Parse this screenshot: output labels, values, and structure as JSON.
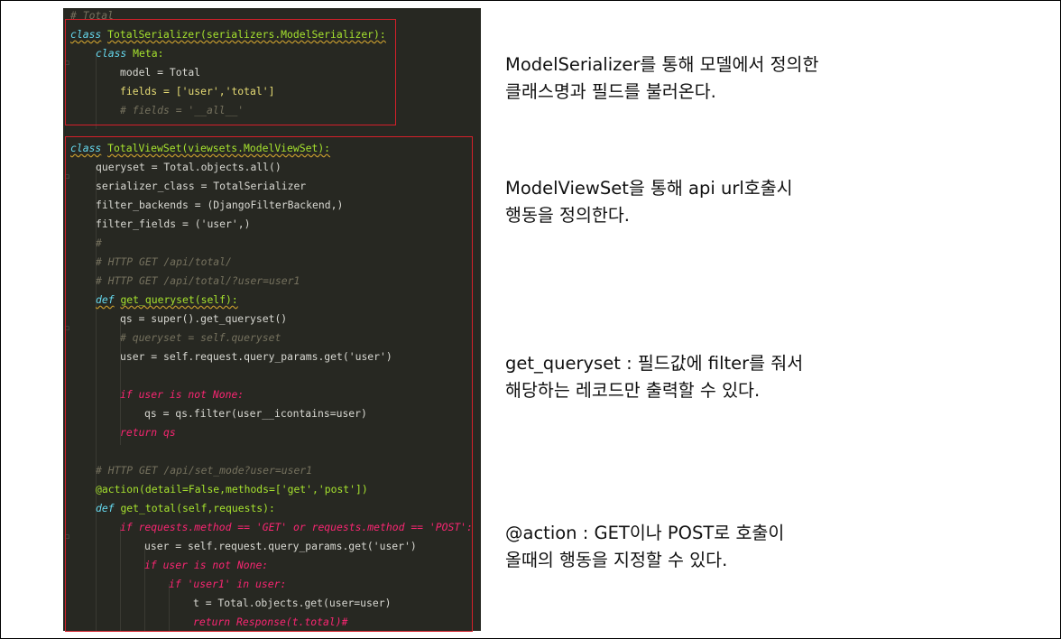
{
  "code": {
    "header_comment": "# Total",
    "serializer": {
      "class_line": "TotalSerializer(serializers.ModelSerializer):",
      "meta_line": "Meta:",
      "model_line": "model = Total",
      "fields_line": "fields = ['user','total']",
      "fields_all_comment": "# fields = '__all__'"
    },
    "viewset": {
      "class_line": "TotalViewSet(viewsets.ModelViewSet):",
      "queryset_line": "queryset = Total.objects.all()",
      "serializer_class_line": "serializer_class = TotalSerializer",
      "filter_backends_line": "filter_backends = (DjangoFilterBackend,)",
      "filter_fields_line": "filter_fields = ('user',)",
      "comment_hash": "#",
      "comment_get_total": "# HTTP GET /api/total/",
      "comment_get_user": "# HTTP GET /api/total/?user=user1",
      "def_get_queryset": "get_queryset(self):",
      "qs_super": "qs = super().get_queryset()",
      "comment_queryset": "# queryset = self.queryset",
      "user_param": "user = self.request.query_params.get('user')",
      "if_user": "if user is not None:",
      "qs_filter": "qs = qs.filter(user__icontains=user)",
      "return_qs": "return qs",
      "comment_set_mode": "# HTTP GET /api/set_mode?user=user1",
      "action_decorator": "@action(detail=False,methods=['get','post'])",
      "def_get_total": "get_total(self,requests):",
      "if_method": "if requests.method == 'GET' or requests.method == 'POST':",
      "user_param2": "user = self.request.query_params.get('user')",
      "if_user2": "if user is not None:",
      "if_user1": "if 'user1' in user:",
      "t_line": "t = Total.objects.get(user=user)",
      "return_response": "return Response(t.total)#"
    }
  },
  "notes": {
    "serializer": [
      "ModelSerializer를 통해 모델에서 정의한",
      "클래스명과 필드를 불러온다."
    ],
    "viewset": [
      "ModelViewSet을 통해 api url호출시",
      "행동을 정의한다."
    ],
    "get_queryset": [
      "get_queryset : 필드값에 filter를 줘서",
      "해당하는 레코드만 출력할 수 있다."
    ],
    "action": [
      "@action : GET이나 POST로 호출이",
      "올때의 행동을 지정할 수 있다."
    ]
  },
  "colors": {
    "editor_background": "#272822",
    "highlight_border": "#d4202a",
    "keyword": "#f92672",
    "string": "#e6db74",
    "function": "#a6e22e",
    "comment": "#75715e"
  }
}
